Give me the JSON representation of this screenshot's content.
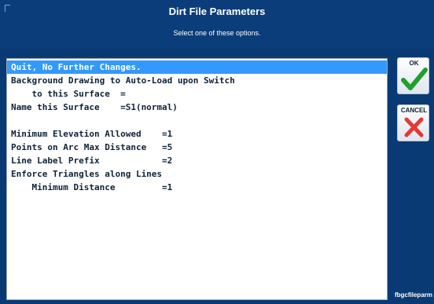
{
  "header": {
    "title": "Dirt File Parameters",
    "subtitle": "Select one of these options."
  },
  "options": [
    "Quit, No Further Changes.",
    "Background Drawing to Auto-Load upon Switch",
    "    to this Surface  =",
    "Name this Surface    =S1(normal)",
    "",
    "Minimum Elevation Allowed    =1",
    "Points on Arc Max Distance   =5",
    "Line Label Prefix            =2",
    "Enforce Triangles along Lines",
    "    Minimum Distance         =1"
  ],
  "buttons": {
    "ok_label": "OK",
    "cancel_label": "CANCEL"
  },
  "footer": "fbgcfileparm",
  "colors": {
    "selection": "#3399ff",
    "ok_check": "#1fa02a",
    "cancel_x": "#e53935",
    "panel_bg": "#0a3a73"
  }
}
